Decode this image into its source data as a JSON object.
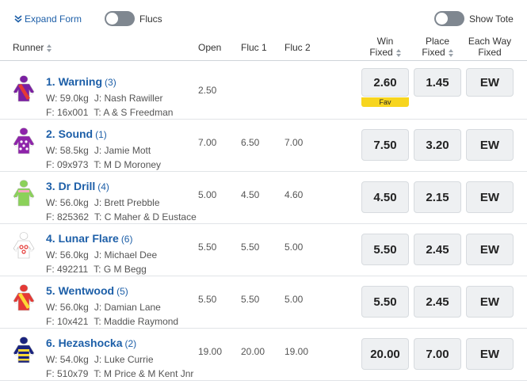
{
  "toolbar": {
    "expand_label": "Expand Form",
    "flucs_label": "Flucs",
    "tote_label": "Show Tote"
  },
  "columns": {
    "runner": "Runner",
    "open": "Open",
    "fluc1": "Fluc 1",
    "fluc2": "Fluc 2",
    "win_l1": "Win",
    "win_l2": "Fixed",
    "place_l1": "Place",
    "place_l2": "Fixed",
    "ew_l1": "Each Way",
    "ew_l2": "Fixed"
  },
  "runners": [
    {
      "name": "1. Warning",
      "barrier": "(3)",
      "weight": "W: 59.0kg",
      "jockey": "J: Nash Rawiller",
      "form": "F: 16x001",
      "trainer": "T: A & S Freedman",
      "open": "2.50",
      "fluc1": "",
      "fluc2": "",
      "win": "2.60",
      "place": "1.45",
      "ew": "EW",
      "badge": "Fav",
      "silk": {
        "main": "#7b1fa2",
        "accent": "#e53935",
        "icon": "jockey-silk-purple-red-sash-icon"
      }
    },
    {
      "name": "2. Sound",
      "barrier": "(1)",
      "weight": "W: 58.5kg",
      "jockey": "J: Jamie Mott",
      "form": "F: 09x973",
      "trainer": "T: M D Moroney",
      "open": "7.00",
      "fluc1": "6.50",
      "fluc2": "7.00",
      "win": "7.50",
      "place": "3.20",
      "ew": "EW",
      "badge": "",
      "silk": {
        "main": "#8e24aa",
        "accent": "#ffffff",
        "icon": "jockey-silk-purple-stars-icon"
      }
    },
    {
      "name": "3. Dr Drill",
      "barrier": "(4)",
      "weight": "W: 56.0kg",
      "jockey": "J: Brett Prebble",
      "form": "F: 825362",
      "trainer": "T: C Maher & D Eustace",
      "open": "5.00",
      "fluc1": "4.50",
      "fluc2": "4.60",
      "win": "4.50",
      "place": "2.15",
      "ew": "EW",
      "badge": "",
      "silk": {
        "main": "#8bd15a",
        "accent": "#f4a7c0",
        "icon": "jockey-silk-green-icon"
      }
    },
    {
      "name": "4. Lunar Flare",
      "barrier": "(6)",
      "weight": "W: 56.0kg",
      "jockey": "J: Michael Dee",
      "form": "F: 492211",
      "trainer": "T: G M Begg",
      "open": "5.50",
      "fluc1": "5.50",
      "fluc2": "5.00",
      "win": "5.50",
      "place": "2.45",
      "ew": "EW",
      "badge": "",
      "silk": {
        "main": "#ffffff",
        "accent": "#e53935",
        "icon": "jockey-silk-white-red-spots-icon"
      }
    },
    {
      "name": "5. Wentwood",
      "barrier": "(5)",
      "weight": "W: 56.0kg",
      "jockey": "J: Damian Lane",
      "form": "F: 10x421",
      "trainer": "T: Maddie Raymond",
      "open": "5.50",
      "fluc1": "5.50",
      "fluc2": "5.00",
      "win": "5.50",
      "place": "2.45",
      "ew": "EW",
      "badge": "",
      "silk": {
        "main": "#e53935",
        "accent": "#fdd835",
        "icon": "jockey-silk-red-yellow-sash-icon"
      }
    },
    {
      "name": "6. Hezashocka",
      "barrier": "(2)",
      "weight": "W: 54.0kg",
      "jockey": "J: Luke Currie",
      "form": "F: 510x79",
      "trainer": "T: M Price & M Kent Jnr",
      "open": "19.00",
      "fluc1": "20.00",
      "fluc2": "19.00",
      "win": "20.00",
      "place": "7.00",
      "ew": "EW",
      "badge": "",
      "silk": {
        "main": "#1a237e",
        "accent": "#fdd835",
        "icon": "jockey-silk-navy-yellow-hoops-icon"
      }
    }
  ]
}
